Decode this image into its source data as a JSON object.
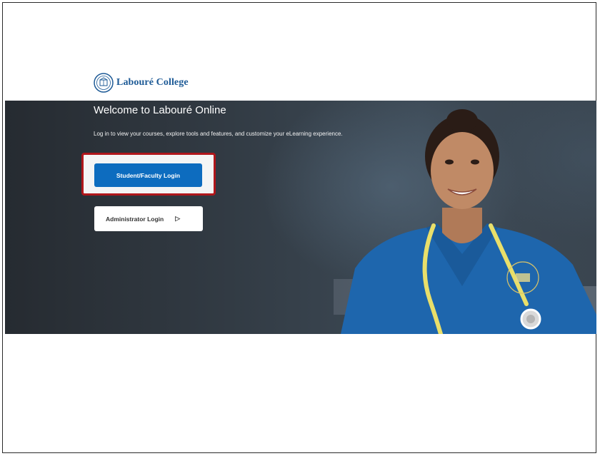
{
  "brand": {
    "name": "Labouré College"
  },
  "hero": {
    "title": "Welcome to Labouré Online",
    "subtitle": "Log in to view your courses, explore tools and features, and customize your eLearning experience."
  },
  "buttons": {
    "student_faculty": "Student/Faculty Login",
    "administrator": "Administrator Login"
  },
  "icons": {
    "logo": "college-seal-icon",
    "administrator_button": "play-arrow-icon"
  },
  "colors": {
    "brand": "#1d5a96",
    "primary_button": "#0d6cbf",
    "highlight_box": "#b0161b",
    "hero_background": "#323b44"
  }
}
